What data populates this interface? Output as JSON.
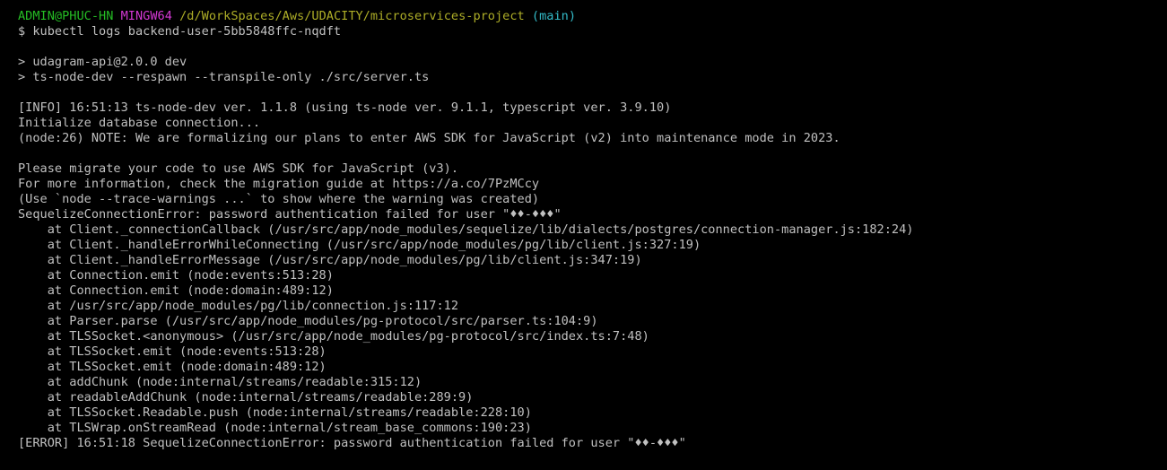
{
  "prompt": {
    "user_host": "ADMIN@PHUC-HN",
    "shell": "MINGW64",
    "path": "/d/WorkSpaces/Aws/UDACITY/microservices-project",
    "branch": "(main)"
  },
  "colors": {
    "background": "#000000",
    "text": "#c0c0c0",
    "user_host": "#25bc24",
    "shell": "#d338d3",
    "path": "#adad27",
    "branch": "#33bbc8"
  },
  "lines": [
    "$ kubectl logs backend-user-5bb5848ffc-nqdft",
    "",
    "> udagram-api@2.0.0 dev",
    "> ts-node-dev --respawn --transpile-only ./src/server.ts",
    "",
    "[INFO] 16:51:13 ts-node-dev ver. 1.1.8 (using ts-node ver. 9.1.1, typescript ver. 3.9.10)",
    "Initialize database connection...",
    "(node:26) NOTE: We are formalizing our plans to enter AWS SDK for JavaScript (v2) into maintenance mode in 2023.",
    "",
    "Please migrate your code to use AWS SDK for JavaScript (v3).",
    "For more information, check the migration guide at https://a.co/7PzMCcy",
    "(Use `node --trace-warnings ...` to show where the warning was created)",
    "SequelizeConnectionError: password authentication failed for user \"♦♦-♦♦♦\"",
    "    at Client._connectionCallback (/usr/src/app/node_modules/sequelize/lib/dialects/postgres/connection-manager.js:182:24)",
    "    at Client._handleErrorWhileConnecting (/usr/src/app/node_modules/pg/lib/client.js:327:19)",
    "    at Client._handleErrorMessage (/usr/src/app/node_modules/pg/lib/client.js:347:19)",
    "    at Connection.emit (node:events:513:28)",
    "    at Connection.emit (node:domain:489:12)",
    "    at /usr/src/app/node_modules/pg/lib/connection.js:117:12",
    "    at Parser.parse (/usr/src/app/node_modules/pg-protocol/src/parser.ts:104:9)",
    "    at TLSSocket.<anonymous> (/usr/src/app/node_modules/pg-protocol/src/index.ts:7:48)",
    "    at TLSSocket.emit (node:events:513:28)",
    "    at TLSSocket.emit (node:domain:489:12)",
    "    at addChunk (node:internal/streams/readable:315:12)",
    "    at readableAddChunk (node:internal/streams/readable:289:9)",
    "    at TLSSocket.Readable.push (node:internal/streams/readable:228:10)",
    "    at TLSWrap.onStreamRead (node:internal/stream_base_commons:190:23)",
    "[ERROR] 16:51:18 SequelizeConnectionError: password authentication failed for user \"♦♦-♦♦♦\""
  ]
}
